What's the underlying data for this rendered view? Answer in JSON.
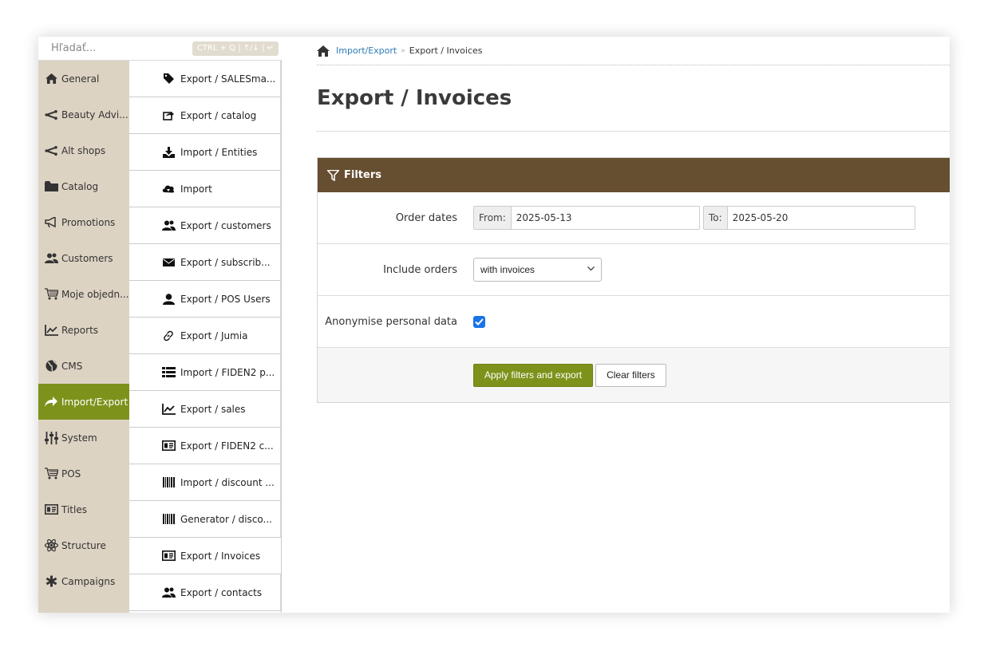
{
  "search": {
    "placeholder": "Hľadať...",
    "hint": "CTRL + Q | ↑/↓ | ↵"
  },
  "sidebar": {
    "items": [
      {
        "label": "General",
        "icon": "home-icon"
      },
      {
        "label": "Beauty Advi...",
        "icon": "share-icon"
      },
      {
        "label": "Alt shops",
        "icon": "share-icon"
      },
      {
        "label": "Catalog",
        "icon": "folder-icon"
      },
      {
        "label": "Promotions",
        "icon": "bullhorn-icon"
      },
      {
        "label": "Customers",
        "icon": "users-icon"
      },
      {
        "label": "Moje objedn...",
        "icon": "cart-icon"
      },
      {
        "label": "Reports",
        "icon": "chart-icon"
      },
      {
        "label": "CMS",
        "icon": "globe-icon"
      },
      {
        "label": "Import/Export",
        "icon": "share-arrow-icon",
        "active": true
      },
      {
        "label": "System",
        "icon": "sliders-icon"
      },
      {
        "label": "POS",
        "icon": "cart-icon"
      },
      {
        "label": "Titles",
        "icon": "id-card-icon"
      },
      {
        "label": "Structure",
        "icon": "atom-icon"
      },
      {
        "label": "Campaigns",
        "icon": "asterisk-icon"
      }
    ]
  },
  "subnav": {
    "items": [
      {
        "label": "Export / SALESma...",
        "icon": "tag-icon"
      },
      {
        "label": "Export / catalog",
        "icon": "external-link-icon"
      },
      {
        "label": "Import / Entities",
        "icon": "download-icon"
      },
      {
        "label": "Import",
        "icon": "cloud-download-icon"
      },
      {
        "label": "Export / customers",
        "icon": "users-icon"
      },
      {
        "label": "Export / subscrib...",
        "icon": "envelope-icon"
      },
      {
        "label": "Export / POS Users",
        "icon": "user-icon"
      },
      {
        "label": "Export / Jumia",
        "icon": "link-icon"
      },
      {
        "label": "Import / FIDEN2 p...",
        "icon": "list-icon"
      },
      {
        "label": "Export / sales",
        "icon": "chart-icon"
      },
      {
        "label": "Export / FIDEN2 c...",
        "icon": "id-card-icon"
      },
      {
        "label": "Import / discount ...",
        "icon": "barcode-icon"
      },
      {
        "label": "Generator / disco...",
        "icon": "barcode-icon"
      },
      {
        "label": "Export / Invoices",
        "icon": "id-card-icon",
        "active": true
      },
      {
        "label": "Export / contacts",
        "icon": "users-icon"
      }
    ]
  },
  "breadcrumb": {
    "parent": "Import/Export",
    "separator": "»",
    "current": "Export / Invoices"
  },
  "page": {
    "title": "Export / Invoices"
  },
  "filters": {
    "header": "Filters",
    "order_dates": {
      "label": "Order dates",
      "from_label": "From:",
      "from_value": "2025-05-13",
      "to_label": "To:",
      "to_value": "2025-05-20"
    },
    "include_orders": {
      "label": "Include orders",
      "value": "with invoices"
    },
    "anonymise": {
      "label": "Anonymise personal data",
      "checked": true
    },
    "apply_label": "Apply filters and export",
    "clear_label": "Clear filters"
  },
  "colors": {
    "accent_green": "#7d921b",
    "panel_header_brown": "#664e31",
    "sidebar_beige": "#ddd3c3",
    "link_blue": "#2a7ab8"
  }
}
